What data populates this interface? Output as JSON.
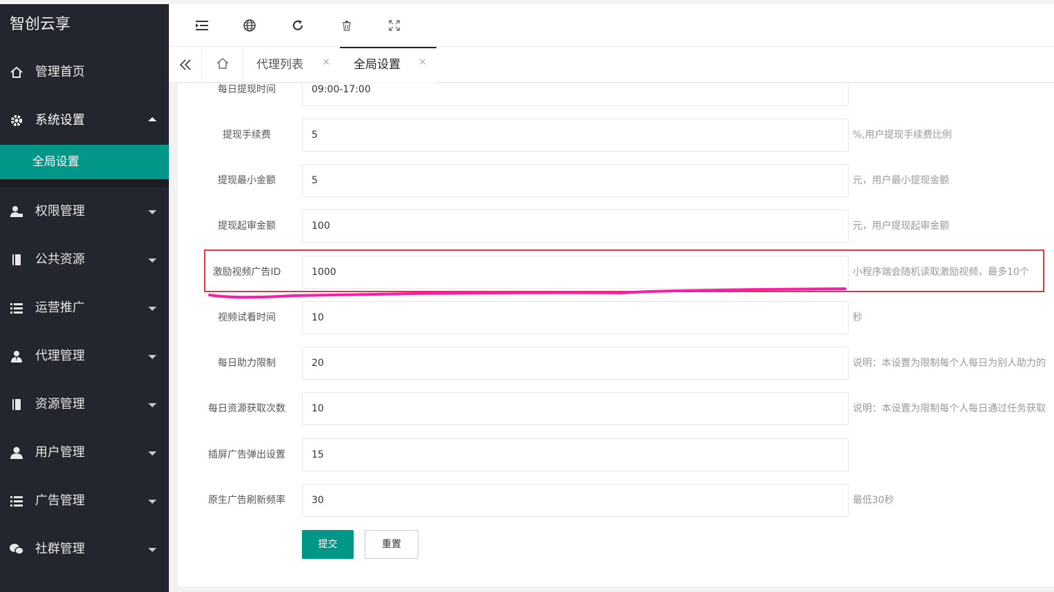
{
  "app": {
    "logo": "智创云享"
  },
  "sidebar": {
    "items": [
      {
        "label": "管理首页",
        "icon": "home-icon"
      },
      {
        "label": "系统设置",
        "icon": "gear-icon"
      },
      {
        "label": "权限管理",
        "icon": "user-lock-icon"
      },
      {
        "label": "公共资源",
        "icon": "book-icon"
      },
      {
        "label": "运营推广",
        "icon": "list-icon"
      },
      {
        "label": "代理管理",
        "icon": "agent-icon"
      },
      {
        "label": "资源管理",
        "icon": "book-icon"
      },
      {
        "label": "用户管理",
        "icon": "user-icon"
      },
      {
        "label": "广告管理",
        "icon": "list-icon"
      },
      {
        "label": "社群管理",
        "icon": "wechat-icon"
      }
    ],
    "subitem": {
      "label": "全局设置"
    }
  },
  "topbar": {
    "tools": [
      "menu-fold-icon",
      "globe-icon",
      "refresh-icon",
      "trash-icon",
      "fullscreen-icon"
    ]
  },
  "tabs": {
    "items": [
      {
        "label": "代理列表",
        "close": "×"
      },
      {
        "label": "全局设置",
        "close": "×"
      }
    ]
  },
  "form": {
    "rows": [
      {
        "label": "每日提现时间",
        "value": "09:00-17:00",
        "note": ""
      },
      {
        "label": "提现手续费",
        "value": "5",
        "note": "%,用户提现手续费比例"
      },
      {
        "label": "提现最小金额",
        "value": "5",
        "note": "元，用户最小提现金额"
      },
      {
        "label": "提现起审金额",
        "value": "100",
        "note": "元，用户提现起审金额"
      },
      {
        "label": "激励视频广告ID",
        "value": "1000",
        "note": "小程序端会随机读取激励视频，最多10个"
      },
      {
        "label": "视频试看时间",
        "value": "10",
        "note": "秒"
      },
      {
        "label": "每日助力限制",
        "value": "20",
        "note": "说明：本设置为限制每个人每日为别人助力的"
      },
      {
        "label": "每日资源获取次数",
        "value": "10",
        "note": "说明：本设置为限制每个人每日通过任务获取"
      },
      {
        "label": "插屏广告弹出设置",
        "value": "15",
        "note": ""
      },
      {
        "label": "原生广告刷新频率",
        "value": "30",
        "note": "最低30秒"
      }
    ],
    "submit_label": "提交",
    "reset_label": "重置"
  },
  "colors": {
    "sidebar_bg": "#23262e",
    "accent": "#009688",
    "highlight": "#e8323c",
    "scribble": "#ff1aa8"
  }
}
